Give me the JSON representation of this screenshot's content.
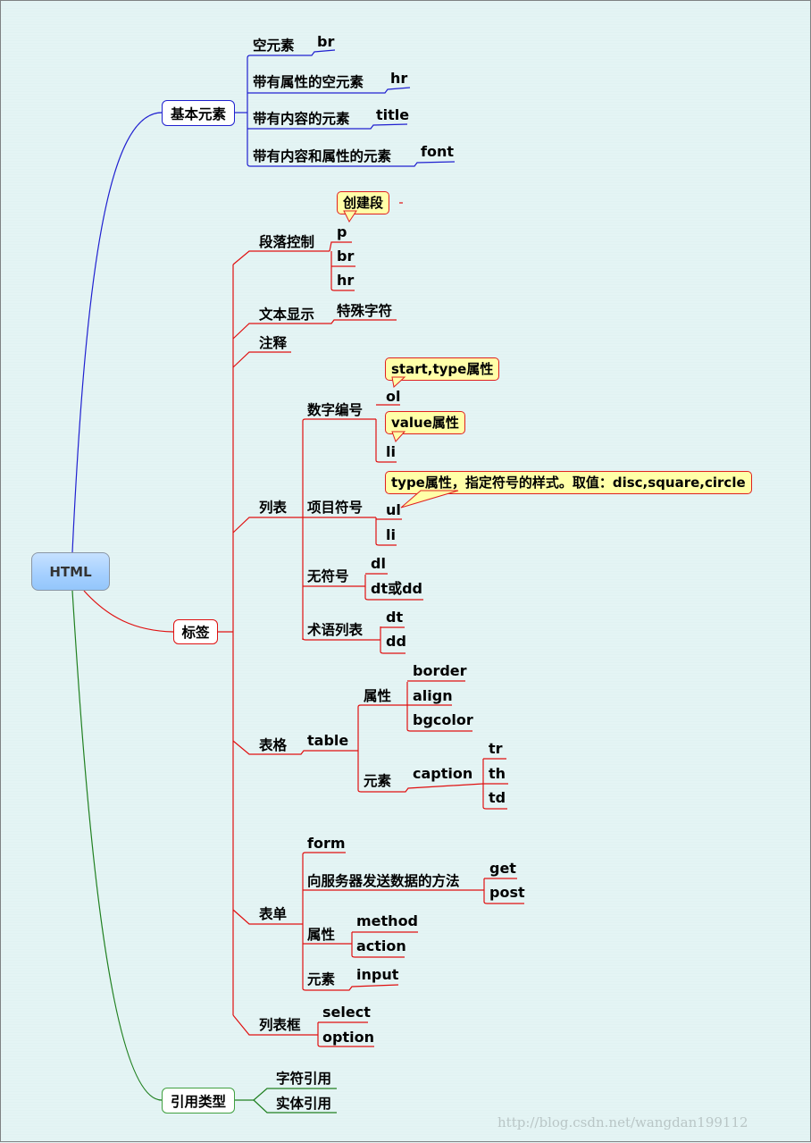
{
  "root": {
    "label": "HTML"
  },
  "colors": {
    "basic_branch": "#2020d0",
    "tags_branch": "#e01010",
    "ref_branch": "#208020",
    "callout_bg": "#ffffa8",
    "root_fill": "#a8d1ff",
    "background": "#e3f3f3"
  },
  "basic": {
    "label": "基本元素",
    "items": [
      {
        "label": "空元素",
        "child": "br"
      },
      {
        "label": "带有属性的空元素",
        "child": "hr"
      },
      {
        "label": "带有内容的元素",
        "child": "title"
      },
      {
        "label": "带有内容和属性的元素",
        "child": "font"
      }
    ]
  },
  "tags": {
    "label": "标签",
    "paragraph": {
      "label": "段落控制",
      "callout": "创建段",
      "children": [
        "p",
        "br",
        "hr"
      ]
    },
    "text_display": {
      "label": "文本显示",
      "child": "特殊字符"
    },
    "comment": {
      "label": "注释"
    },
    "list": {
      "label": "列表",
      "ordered": {
        "label": "数字编号",
        "ol": "ol",
        "ol_callout": "start,type属性",
        "li": "li",
        "li_callout": "value属性"
      },
      "bullet": {
        "label": "项目符号",
        "ul": "ul",
        "ul_callout": "type属性，指定符号的样式。取值：disc,square,circle",
        "li": "li"
      },
      "unmarked": {
        "label": "无符号",
        "children": [
          "dl",
          "dt或dd"
        ]
      },
      "term": {
        "label": "术语列表",
        "children": [
          "dt",
          "dd"
        ]
      }
    },
    "table": {
      "label": "表格",
      "tag": "table",
      "attrs": {
        "label": "属性",
        "children": [
          "border",
          "align",
          "bgcolor"
        ]
      },
      "elements": {
        "label": "元素",
        "caption": "caption",
        "children": [
          "tr",
          "th",
          "td"
        ]
      }
    },
    "form": {
      "label": "表单",
      "form_tag": "form",
      "method_label": "向服务器发送数据的方法",
      "methods": [
        "get",
        "post"
      ],
      "attrs": {
        "label": "属性",
        "children": [
          "method",
          "action"
        ]
      },
      "elements": {
        "label": "元素",
        "child": "input"
      }
    },
    "listbox": {
      "label": "列表框",
      "children": [
        "select",
        "option"
      ]
    }
  },
  "refs": {
    "label": "引用类型",
    "children": [
      "字符引用",
      "实体引用"
    ]
  },
  "watermark": "http://blog.csdn.net/wangdan199112"
}
